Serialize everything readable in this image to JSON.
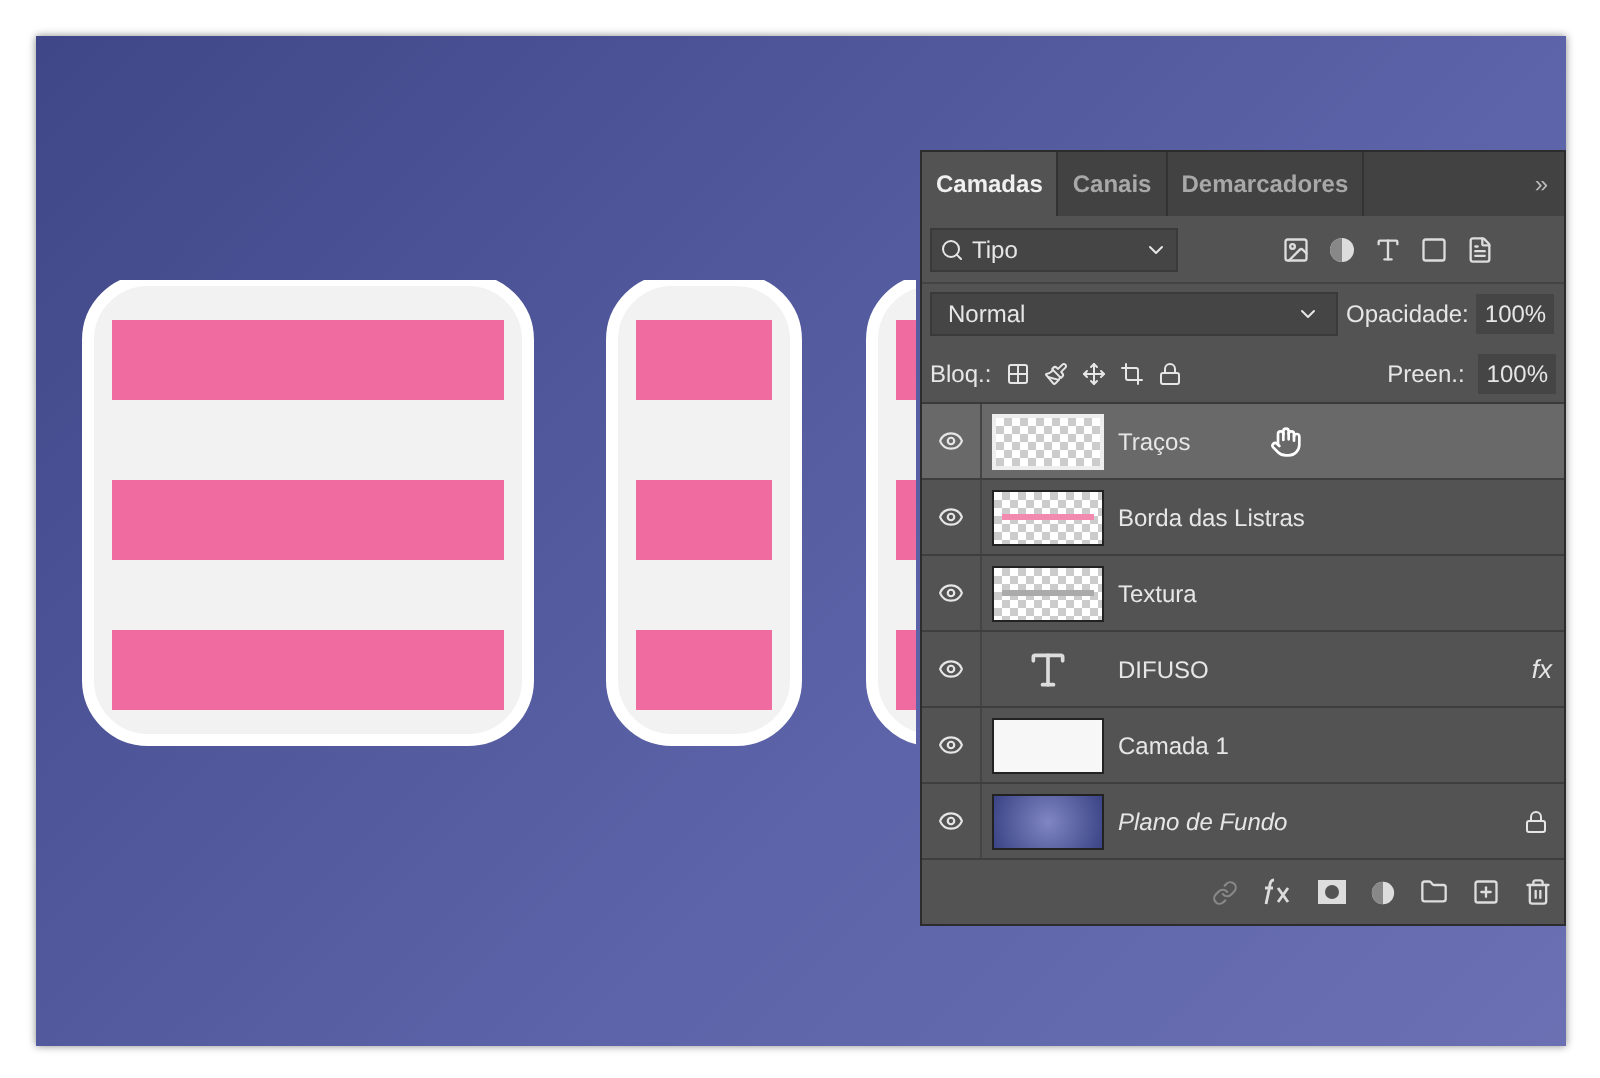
{
  "tabs": [
    {
      "label": "Camadas",
      "selected": true
    },
    {
      "label": "Canais",
      "selected": false
    },
    {
      "label": "Demarcadores",
      "selected": false
    }
  ],
  "panel_menu": "»",
  "filter": {
    "value": "Tipo"
  },
  "blend_mode": {
    "value": "Normal"
  },
  "opacity": {
    "label": "Opacidade:",
    "value": "100%"
  },
  "lock": {
    "label": "Bloq.:"
  },
  "fill": {
    "label": "Preen.:",
    "value": "100%"
  },
  "layers": [
    {
      "name": "Traços",
      "kind": "empty",
      "selected": true,
      "visible": true,
      "locked": false
    },
    {
      "name": "Borda das Listras",
      "kind": "stripes",
      "selected": false,
      "visible": true,
      "locked": false
    },
    {
      "name": "Textura",
      "kind": "texture",
      "selected": false,
      "visible": true,
      "locked": false
    },
    {
      "name": "DIFUSO",
      "kind": "text",
      "selected": false,
      "visible": true,
      "effects": "fx",
      "locked": false
    },
    {
      "name": "Camada 1",
      "kind": "white",
      "selected": false,
      "visible": true,
      "locked": false
    },
    {
      "name": "Plano de Fundo",
      "kind": "background",
      "selected": false,
      "visible": true,
      "locked": true
    }
  ]
}
